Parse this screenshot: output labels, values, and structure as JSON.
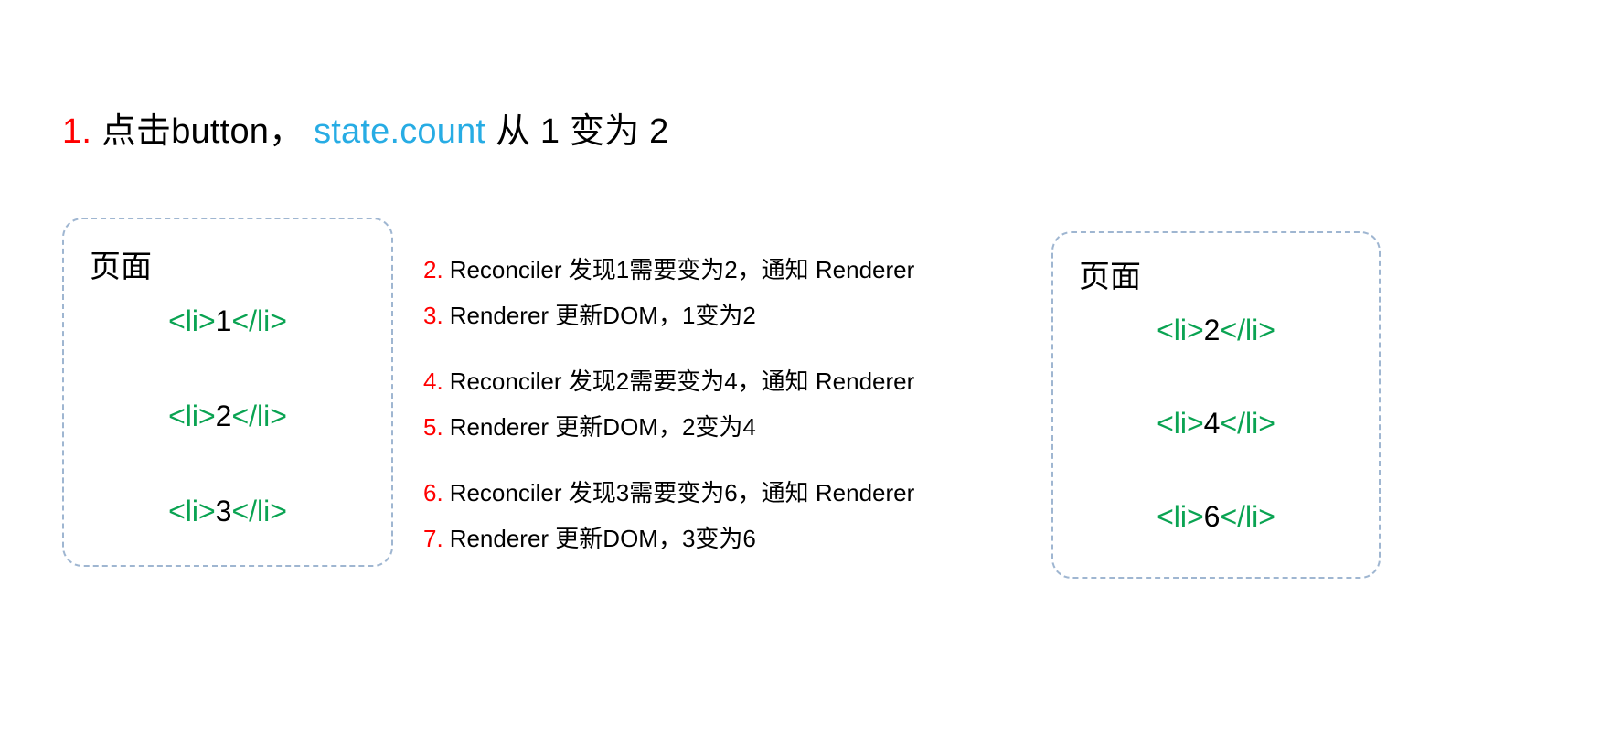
{
  "title": {
    "index": "1.",
    "text_before": "点击button，",
    "code": "state.count",
    "text_after": "从 1 变为 2",
    "index_color": "#ff0000",
    "code_color": "#27ace4"
  },
  "colors": {
    "tag_green": "#0aa352",
    "step_index_red": "#ff0000",
    "box_border": "#9fb6d1",
    "text_black": "#000000",
    "background": "#ffffff"
  },
  "before_box": {
    "heading": "页面",
    "items": [
      {
        "open": "<li>",
        "value": "1",
        "close": "</li>"
      },
      {
        "open": "<li>",
        "value": "2",
        "close": "</li>"
      },
      {
        "open": "<li>",
        "value": "3",
        "close": "</li>"
      }
    ]
  },
  "after_box": {
    "heading": "页面",
    "items": [
      {
        "open": "<li>",
        "value": "2",
        "close": "</li>"
      },
      {
        "open": "<li>",
        "value": "4",
        "close": "</li>"
      },
      {
        "open": "<li>",
        "value": "6",
        "close": "</li>"
      }
    ]
  },
  "steps": [
    {
      "reconcile": {
        "index": "2.",
        "text": "Reconciler 发现1需要变为2，通知 Renderer"
      },
      "render": {
        "index": "3.",
        "text": "Renderer 更新DOM，1变为2"
      }
    },
    {
      "reconcile": {
        "index": "4.",
        "text": "Reconciler 发现2需要变为4，通知 Renderer"
      },
      "render": {
        "index": "5.",
        "text": "Renderer 更新DOM，2变为4"
      }
    },
    {
      "reconcile": {
        "index": "6.",
        "text": "Reconciler 发现3需要变为6，通知 Renderer"
      },
      "render": {
        "index": "7.",
        "text": "Renderer 更新DOM，3变为6"
      }
    }
  ]
}
